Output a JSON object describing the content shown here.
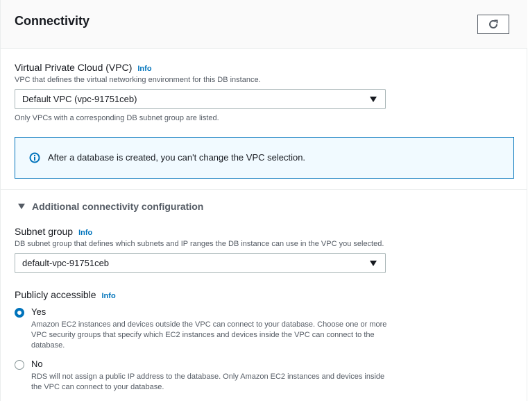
{
  "header": {
    "title": "Connectivity"
  },
  "vpc": {
    "label": "Virtual Private Cloud (VPC)",
    "info": "Info",
    "description": "VPC that defines the virtual networking environment for this DB instance.",
    "selected": "Default VPC (vpc-91751ceb)",
    "hint": "Only VPCs with a corresponding DB subnet group are listed."
  },
  "alert": {
    "text": "After a database is created, you can't change the VPC selection."
  },
  "additional": {
    "label": "Additional connectivity configuration"
  },
  "subnet": {
    "label": "Subnet group",
    "info": "Info",
    "description": "DB subnet group that defines which subnets and IP ranges the DB instance can use in the VPC you selected.",
    "selected": "default-vpc-91751ceb"
  },
  "public": {
    "label": "Publicly accessible",
    "info": "Info",
    "options": [
      {
        "label": "Yes",
        "description": "Amazon EC2 instances and devices outside the VPC can connect to your database. Choose one or more VPC security groups that specify which EC2 instances and devices inside the VPC can connect to the database."
      },
      {
        "label": "No",
        "description": "RDS will not assign a public IP address to the database. Only Amazon EC2 instances and devices inside the VPC can connect to your database."
      }
    ]
  }
}
